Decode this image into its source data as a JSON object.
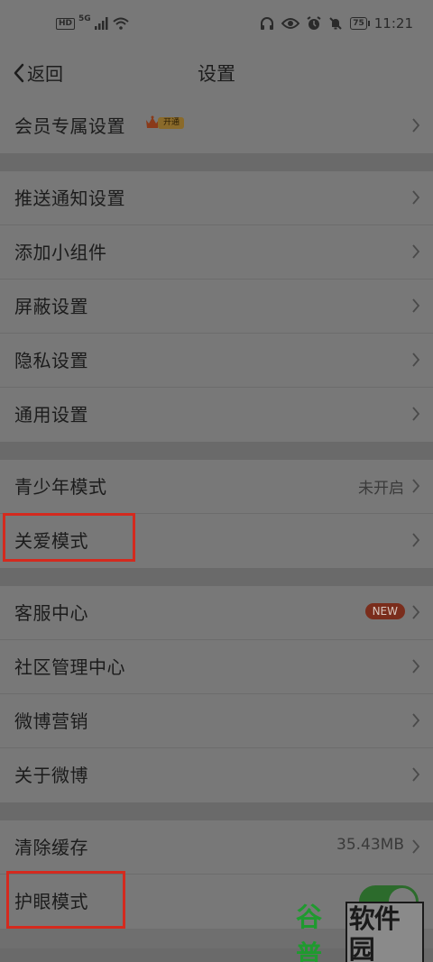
{
  "status_bar": {
    "hd": "HD",
    "net": "5G",
    "battery": "75",
    "time": "11:21"
  },
  "nav": {
    "back_label": "返回",
    "title": "设置"
  },
  "vip": {
    "label": "会员专属设置",
    "badge": "开通"
  },
  "group1": [
    {
      "label": "推送通知设置"
    },
    {
      "label": "添加小组件"
    },
    {
      "label": "屏蔽设置"
    },
    {
      "label": "隐私设置"
    },
    {
      "label": "通用设置"
    }
  ],
  "group2": [
    {
      "label": "青少年模式",
      "value": "未开启"
    },
    {
      "label": "关爱模式"
    }
  ],
  "group3": [
    {
      "label": "客服中心",
      "badge": "NEW"
    },
    {
      "label": "社区管理中心"
    },
    {
      "label": "微博营销"
    },
    {
      "label": "关于微博"
    }
  ],
  "group4": [
    {
      "label": "清除缓存",
      "value": "35.43MB"
    },
    {
      "label": "护眼模式",
      "toggle": true
    }
  ],
  "watermark": {
    "left": "谷普",
    "right": "软件园"
  },
  "colors": {
    "highlight": "#d42a1e",
    "toggle_on": "#2c6b2c",
    "watermark": "#1f9a2f"
  }
}
